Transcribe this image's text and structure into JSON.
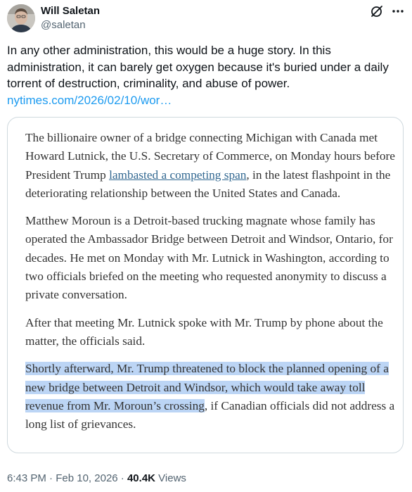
{
  "author": {
    "display_name": "Will Saletan",
    "handle": "@saletan"
  },
  "tweet": {
    "text": "In any other administration, this would be a huge story. In this administration, it can barely get oxygen because it's buried under a daily torrent of destruction, criminality, and abuse of power.",
    "link_text": "nytimes.com/2026/02/10/wor…"
  },
  "article": {
    "p1_before": "The billionaire owner of a bridge connecting Michigan with Canada met Howard Lutnick, the U.S. Secretary of Commerce, on Monday hours before President Trump ",
    "p1_link": "lambasted a competing span",
    "p1_after": ", in the latest flashpoint in the deteriorating relationship between the United States and Canada.",
    "p2": "Matthew Moroun is a Detroit-based trucking magnate whose family has operated the Ambassador Bridge between Detroit and Windsor, Ontario, for decades. He met on Monday with Mr. Lutnick in Washington, according to two officials briefed on the meeting who requested anonymity to discuss a private conversation.",
    "p3": "After that meeting Mr. Lutnick spoke with Mr. Trump by phone about the matter, the officials said.",
    "p4_highlighted": "Shortly afterward, Mr. Trump threatened to block the planned opening of a new bridge between Detroit and Windsor, which would take away toll revenue from Mr. Moroun’s crossing",
    "p4_rest": ", if Canadian officials did not address a long list of grievances."
  },
  "meta": {
    "time": "6:43 PM",
    "separator": " · ",
    "date": "Feb 10, 2026",
    "separator2": " · ",
    "views_count": "40.4K",
    "views_label": " Views"
  },
  "colors": {
    "link": "#1d9bf0",
    "highlight": "#bcd5f5",
    "article_link": "#326891",
    "secondary_text": "#536471"
  },
  "icons": [
    "avatar",
    "grok-icon",
    "more-icon"
  ]
}
